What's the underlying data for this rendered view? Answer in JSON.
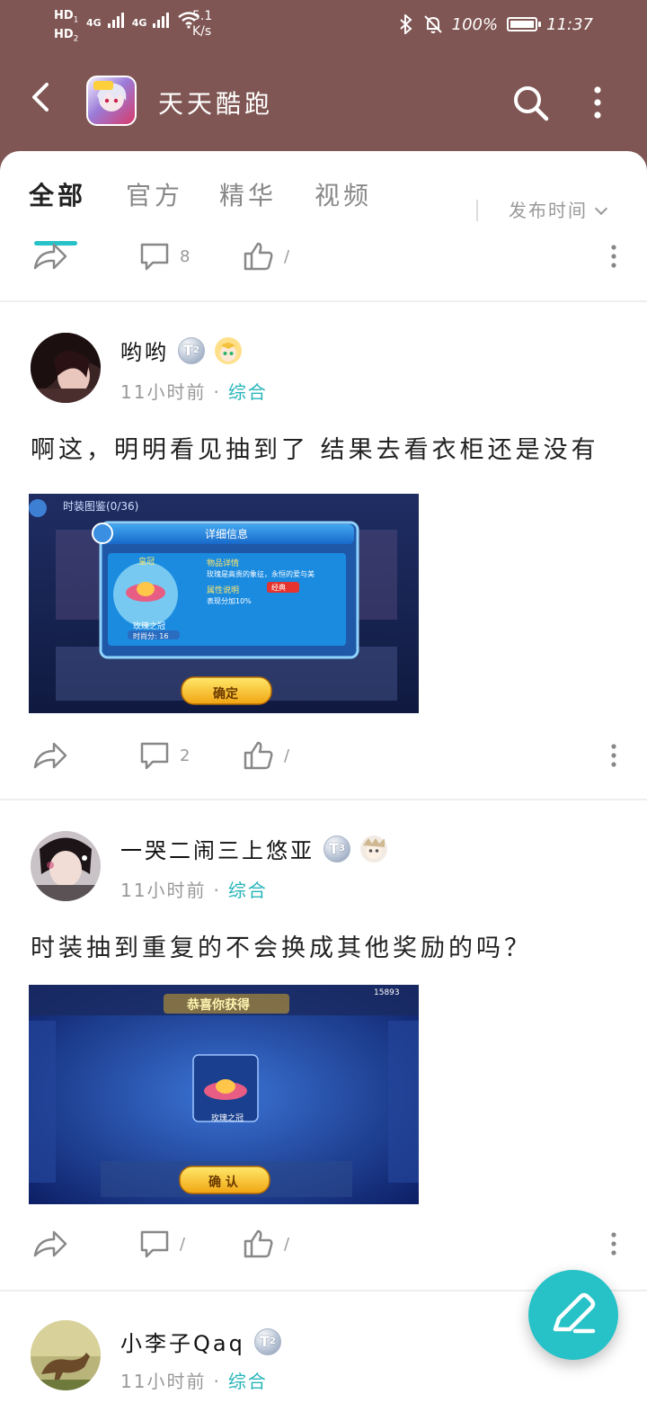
{
  "status_bar": {
    "hd1": "HD",
    "hd1_sub": "1",
    "hd2": "HD",
    "hd2_sub": "2",
    "net1": "4G",
    "net2": "4G",
    "speed_value": "5.1",
    "speed_unit": "K/s",
    "battery": "100%",
    "time": "11:37"
  },
  "app_bar": {
    "title": "天天酷跑",
    "icon": "game-app-icon"
  },
  "tabs": [
    {
      "label": "全部",
      "active": true
    },
    {
      "label": "官方",
      "active": false
    },
    {
      "label": "精华",
      "active": false
    },
    {
      "label": "视频",
      "active": false
    }
  ],
  "sort": {
    "label": "发布时间"
  },
  "top_actions": {
    "comments": "8",
    "likes": "/"
  },
  "posts": [
    {
      "username": "哟哟",
      "level": "T",
      "level_sub": "2",
      "time": "11小时前",
      "category": "综合",
      "text": "啊这，明明看见抽到了 结果去看衣柜还是没有",
      "screenshot": {
        "header": "时装图鉴(0/36)",
        "dialog_title": "详细信息",
        "item_name": "皇冠",
        "section1": "物品详情",
        "section1_text": "玫瑰是高贵的象征，永恒的爱与美",
        "section2": "属性说明",
        "section2_tag": "经典",
        "section2_text": "表现分加10%",
        "item_caption": "玫瑰之冠",
        "score": "时尚分: 16",
        "button": "确定"
      },
      "comments": "2",
      "likes": "/"
    },
    {
      "username": "一哭二闹三上悠亚",
      "level": "T",
      "level_sub": "3",
      "time": "11小时前",
      "category": "综合",
      "text": "时装抽到重复的不会换成其他奖励的吗？",
      "screenshot": {
        "banner": "恭喜你获得",
        "item_caption": "玫瑰之冠",
        "button": "确 认",
        "counter": "15893"
      },
      "comments": "/",
      "likes": "/"
    },
    {
      "username": "小李子Qaq",
      "level": "T",
      "level_sub": "2",
      "time": "11小时前",
      "category": "综合"
    }
  ],
  "colors": {
    "header_bg": "#7f5653",
    "accent": "#27c2c7",
    "category": "#27b5ba"
  }
}
